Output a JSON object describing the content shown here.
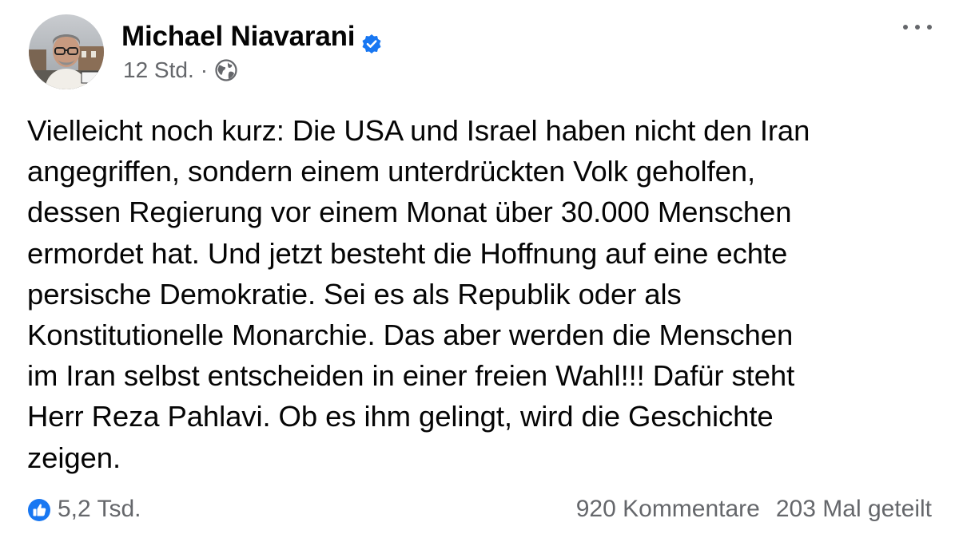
{
  "post": {
    "author": "Michael Niavarani",
    "verified_icon": "verified-badge-icon",
    "timestamp": "12 Std.",
    "separator": "·",
    "audience_icon": "globe-icon",
    "more_icon": "more-options-icon",
    "text": "Vielleicht noch kurz: Die USA und Israel haben nicht den Iran\nangegriffen, sondern einem unterdrückten Volk geholfen,\ndessen Regierung vor einem Monat über 30.000 Menschen\nermordet hat. Und jetzt besteht die Hoffnung auf eine echte\npersische Demokratie. Sei es als Republik oder als\nKonstitutionelle Monarchie. Das aber werden die Menschen\nim Iran selbst entscheiden in einer freien Wahl!!! Dafür steht\nHerr Reza Pahlavi. Ob es ihm gelingt, wird die Geschichte\nzeigen."
  },
  "footer": {
    "reactions_count": "5,2 Tsd.",
    "comments": "920 Kommentare",
    "shares": "203 Mal geteilt"
  },
  "colors": {
    "text": "#050505",
    "secondary": "#65676b",
    "accent": "#1877f2"
  }
}
